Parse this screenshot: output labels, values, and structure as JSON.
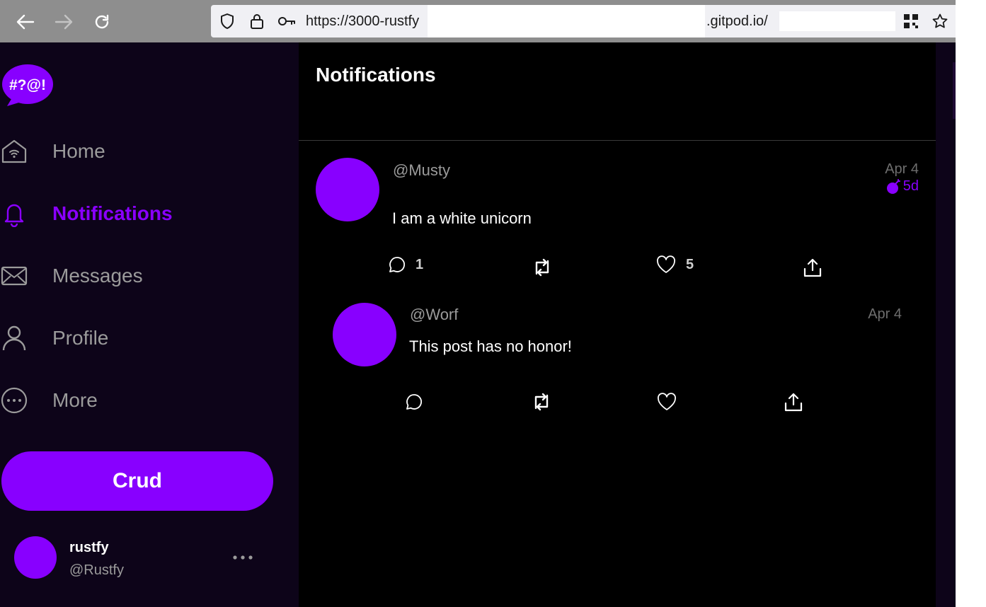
{
  "browser": {
    "url_prefix": "https://3000-rustfy",
    "url_suffix": ".gitpod.io/"
  },
  "logo": {
    "text": "#?@!",
    "color": "#8800ff"
  },
  "sidebar": {
    "items": [
      {
        "label": "Home",
        "icon": "home-icon",
        "active": false
      },
      {
        "label": "Notifications",
        "icon": "bell-icon",
        "active": true
      },
      {
        "label": "Messages",
        "icon": "envelope-icon",
        "active": false
      },
      {
        "label": "Profile",
        "icon": "person-icon",
        "active": false
      },
      {
        "label": "More",
        "icon": "more-circle-icon",
        "active": false
      }
    ],
    "post_button": "Crud",
    "user": {
      "name": "rustfy",
      "handle": "@Rustfy"
    }
  },
  "main": {
    "title": "Notifications",
    "posts": [
      {
        "handle": "@Musty",
        "date": "Apr 4",
        "badge": "5d",
        "text": "I am a white unicorn",
        "actions": {
          "replies": "1",
          "likes": "5"
        }
      },
      {
        "handle": "@Worf",
        "date": "Apr 4",
        "text": "This post has no honor!",
        "actions": {
          "replies": "",
          "likes": ""
        }
      }
    ]
  },
  "colors": {
    "accent": "#8800ff",
    "background": "#000000",
    "sidebar": "#0d0419"
  }
}
